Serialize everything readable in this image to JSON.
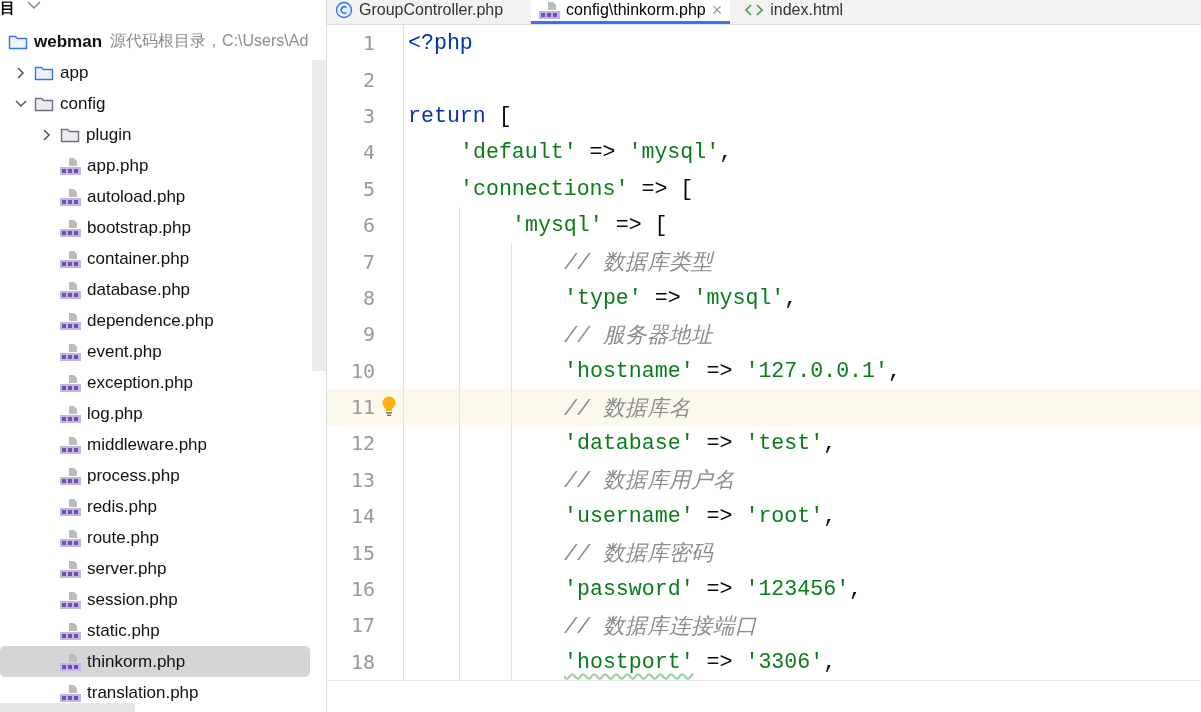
{
  "sidebar": {
    "title": "目",
    "tree": [
      {
        "label": "webman",
        "hint": "源代码根目录，C:\\Users\\Ad",
        "kind": "root",
        "selected": false,
        "children": [
          {
            "label": "app",
            "kind": "source-folder",
            "expanded": false,
            "selected": false
          },
          {
            "label": "config",
            "kind": "folder",
            "expanded": true,
            "selected": false,
            "children": [
              {
                "label": "plugin",
                "kind": "folder",
                "expanded": false,
                "selected": false
              },
              {
                "label": "app.php",
                "kind": "php-file",
                "selected": false
              },
              {
                "label": "autoload.php",
                "kind": "php-file",
                "selected": false
              },
              {
                "label": "bootstrap.php",
                "kind": "php-file",
                "selected": false
              },
              {
                "label": "container.php",
                "kind": "php-file",
                "selected": false
              },
              {
                "label": "database.php",
                "kind": "php-file",
                "selected": false
              },
              {
                "label": "dependence.php",
                "kind": "php-file",
                "selected": false
              },
              {
                "label": "event.php",
                "kind": "php-file",
                "selected": false
              },
              {
                "label": "exception.php",
                "kind": "php-file",
                "selected": false
              },
              {
                "label": "log.php",
                "kind": "php-file",
                "selected": false
              },
              {
                "label": "middleware.php",
                "kind": "php-file",
                "selected": false
              },
              {
                "label": "process.php",
                "kind": "php-file",
                "selected": false
              },
              {
                "label": "redis.php",
                "kind": "php-file",
                "selected": false
              },
              {
                "label": "route.php",
                "kind": "php-file",
                "selected": false
              },
              {
                "label": "server.php",
                "kind": "php-file",
                "selected": false
              },
              {
                "label": "session.php",
                "kind": "php-file",
                "selected": false
              },
              {
                "label": "static.php",
                "kind": "php-file",
                "selected": false
              },
              {
                "label": "thinkorm.php",
                "kind": "php-file",
                "selected": true
              },
              {
                "label": "translation.php",
                "kind": "php-file",
                "selected": false
              }
            ]
          }
        ]
      }
    ]
  },
  "tabs": [
    {
      "label": "GroupController.php",
      "kind": "class",
      "selected": false
    },
    {
      "label": "config\\thinkorm.php",
      "kind": "php",
      "selected": true,
      "close": "×"
    },
    {
      "label": "index.html",
      "kind": "html",
      "selected": false
    }
  ],
  "editor": {
    "lines": [
      {
        "number": "1",
        "current": false,
        "tokens": [
          {
            "kind": "keyword",
            "text": "<?php"
          }
        ]
      },
      {
        "number": "2",
        "current": false
      },
      {
        "number": "3",
        "current": false,
        "tokens": [
          {
            "kind": "keyword",
            "text": "return"
          },
          {
            "kind": "plain",
            "text": " ["
          }
        ],
        "children": [
          {
            "number": "4",
            "current": false,
            "tokens": [
              {
                "kind": "string",
                "text": "'default'"
              },
              {
                "kind": "plain",
                "text": " => "
              },
              {
                "kind": "string",
                "text": "'mysql'"
              },
              {
                "kind": "plain",
                "text": ","
              }
            ]
          },
          {
            "number": "5",
            "current": false,
            "tokens": [
              {
                "kind": "string",
                "text": "'connections'"
              },
              {
                "kind": "plain",
                "text": " => ["
              }
            ],
            "children": [
              {
                "number": "6",
                "current": false,
                "tokens": [
                  {
                    "kind": "string",
                    "text": "'mysql'"
                  },
                  {
                    "kind": "plain",
                    "text": " => ["
                  }
                ],
                "children": [
                  {
                    "number": "7",
                    "current": false,
                    "tokens": [
                      {
                        "kind": "comment",
                        "text": "// 数据库类型"
                      }
                    ]
                  },
                  {
                    "number": "8",
                    "current": false,
                    "tokens": [
                      {
                        "kind": "string",
                        "text": "'type'"
                      },
                      {
                        "kind": "plain",
                        "text": " => "
                      },
                      {
                        "kind": "string",
                        "text": "'mysql'"
                      },
                      {
                        "kind": "plain",
                        "text": ","
                      }
                    ]
                  },
                  {
                    "number": "9",
                    "current": false,
                    "tokens": [
                      {
                        "kind": "comment",
                        "text": "// 服务器地址"
                      }
                    ]
                  },
                  {
                    "number": "10",
                    "current": false,
                    "tokens": [
                      {
                        "kind": "string",
                        "text": "'hostname'"
                      },
                      {
                        "kind": "plain",
                        "text": " => "
                      },
                      {
                        "kind": "string",
                        "text": "'127.0.0.1'"
                      },
                      {
                        "kind": "plain",
                        "text": ","
                      }
                    ]
                  },
                  {
                    "number": "11",
                    "current": true,
                    "hint": true,
                    "tokens": [
                      {
                        "kind": "comment",
                        "text": "// 数据库名"
                      }
                    ]
                  },
                  {
                    "number": "12",
                    "current": false,
                    "tokens": [
                      {
                        "kind": "string",
                        "text": "'database'"
                      },
                      {
                        "kind": "plain",
                        "text": " => "
                      },
                      {
                        "kind": "string",
                        "text": "'test'"
                      },
                      {
                        "kind": "plain",
                        "text": ","
                      }
                    ]
                  },
                  {
                    "number": "13",
                    "current": false,
                    "tokens": [
                      {
                        "kind": "comment",
                        "text": "// 数据库用户名"
                      }
                    ]
                  },
                  {
                    "number": "14",
                    "current": false,
                    "tokens": [
                      {
                        "kind": "string",
                        "text": "'username'"
                      },
                      {
                        "kind": "plain",
                        "text": " => "
                      },
                      {
                        "kind": "string",
                        "text": "'root'"
                      },
                      {
                        "kind": "plain",
                        "text": ","
                      }
                    ]
                  },
                  {
                    "number": "15",
                    "current": false,
                    "tokens": [
                      {
                        "kind": "comment",
                        "text": "// 数据库密码"
                      }
                    ]
                  },
                  {
                    "number": "16",
                    "current": false,
                    "tokens": [
                      {
                        "kind": "string",
                        "text": "'password'"
                      },
                      {
                        "kind": "plain",
                        "text": " => "
                      },
                      {
                        "kind": "string",
                        "text": "'123456'"
                      },
                      {
                        "kind": "plain",
                        "text": ","
                      }
                    ]
                  },
                  {
                    "number": "17",
                    "current": false,
                    "tokens": [
                      {
                        "kind": "comment",
                        "text": "// 数据库连接端口"
                      }
                    ]
                  },
                  {
                    "number": "18",
                    "current": false,
                    "tokens": [
                      {
                        "kind": "typo",
                        "text": "'hostport'"
                      },
                      {
                        "kind": "plain",
                        "text": " => "
                      },
                      {
                        "kind": "string",
                        "text": "'3306'"
                      },
                      {
                        "kind": "plain",
                        "text": ","
                      }
                    ]
                  }
                ]
              }
            ]
          }
        ]
      }
    ]
  }
}
